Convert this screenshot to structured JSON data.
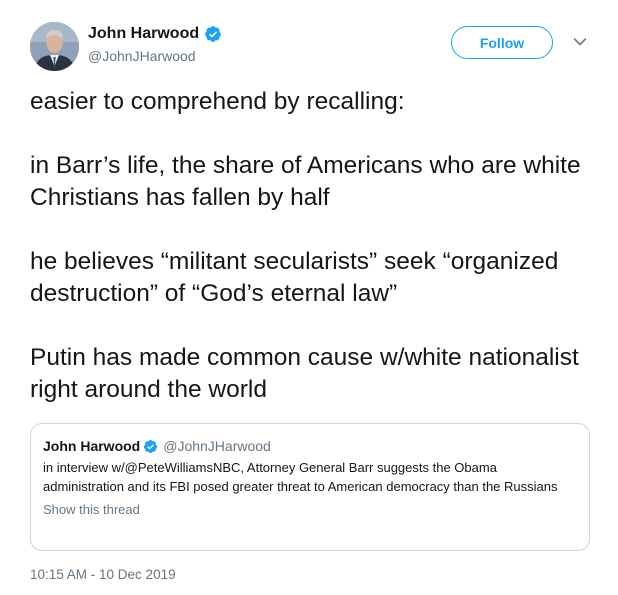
{
  "author": {
    "display_name": "John Harwood",
    "handle": "@JohnJHarwood",
    "verified": true
  },
  "follow_button": {
    "label": "Follow"
  },
  "more_menu": {
    "icon": "chevron-down-icon"
  },
  "tweet": {
    "paragraphs": [
      "easier to comprehend by recalling:",
      "in Barr’s life, the share of Americans who are white Christians has fallen by half",
      "he believes “militant secularists” seek “organized destruction” of “God’s eternal law”",
      "Putin has made common cause w/white nationalist right around the world"
    ],
    "timestamp": "10:15 AM - 10 Dec 2019"
  },
  "quoted_tweet": {
    "display_name": "John Harwood",
    "handle": "@JohnJHarwood",
    "verified": true,
    "text": "in interview w/@PeteWilliamsNBC, Attorney General Barr suggests the Obama administration and its FBI posed greater threat to American democracy than the Russians",
    "show_thread_label": "Show this thread"
  },
  "colors": {
    "accent": "#1da1f2",
    "text": "#14171a",
    "muted": "#657786",
    "border": "#ccd6dd"
  }
}
